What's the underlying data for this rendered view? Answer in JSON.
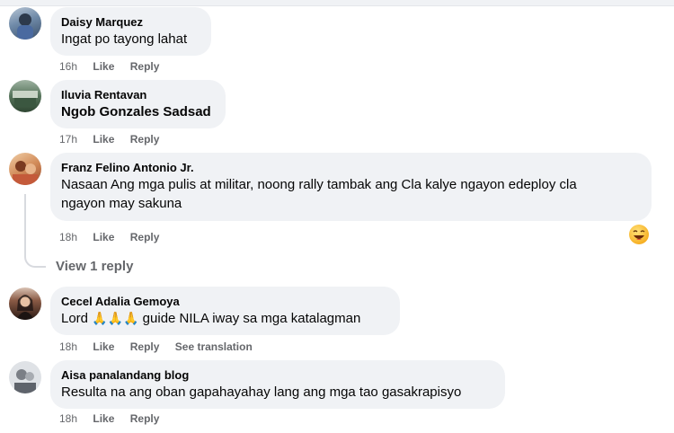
{
  "comments": [
    {
      "author": "Daisy Marquez",
      "text": "Ingat po tayong lahat",
      "time": "16h",
      "like": "Like",
      "reply": "Reply"
    },
    {
      "author": "Iluvia Rentavan",
      "text": "Ngob Gonzales Sadsad",
      "time": "17h",
      "like": "Like",
      "reply": "Reply"
    },
    {
      "author": "Franz Felino Antonio Jr.",
      "text_line1": "Nasaan Ang mga pulis at militar, noong rally tambak ang Cla kalye ngayon edeploy cla",
      "text_line2": "ngayon may sakuna",
      "time": "18h",
      "like": "Like",
      "reply": "Reply",
      "view_replies": "View 1 reply"
    },
    {
      "author": "Cecel Adalia Gemoya",
      "text_before": "Lord",
      "emoji": "🙏🙏🙏",
      "text_after": "guide NILA iway sa mga katalagman",
      "time": "18h",
      "like": "Like",
      "reply": "Reply",
      "see_translation": "See translation"
    },
    {
      "author": "Aisa panalandang blog",
      "text": "Resulta na ang oban gapahayahay lang ang mga tao gasakrapisyo",
      "time": "18h",
      "like": "Like",
      "reply": "Reply"
    }
  ],
  "reaction_icon": "laughing-emoji-icon"
}
